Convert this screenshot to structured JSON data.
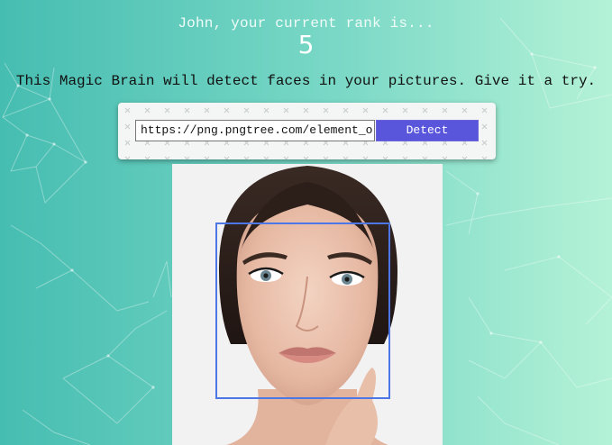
{
  "rank": {
    "message": "John, your current rank is...",
    "value": "5"
  },
  "intro_text": "This Magic Brain will detect faces in your pictures. Give it a try.",
  "form": {
    "url_value": "https://png.pngtree.com/element_orig",
    "detect_label": "Detect"
  },
  "colors": {
    "detect_button": "#5a56dc",
    "face_box": "#4d77e6",
    "background_start": "#46bdb1",
    "background_end": "#b4f2d7"
  }
}
